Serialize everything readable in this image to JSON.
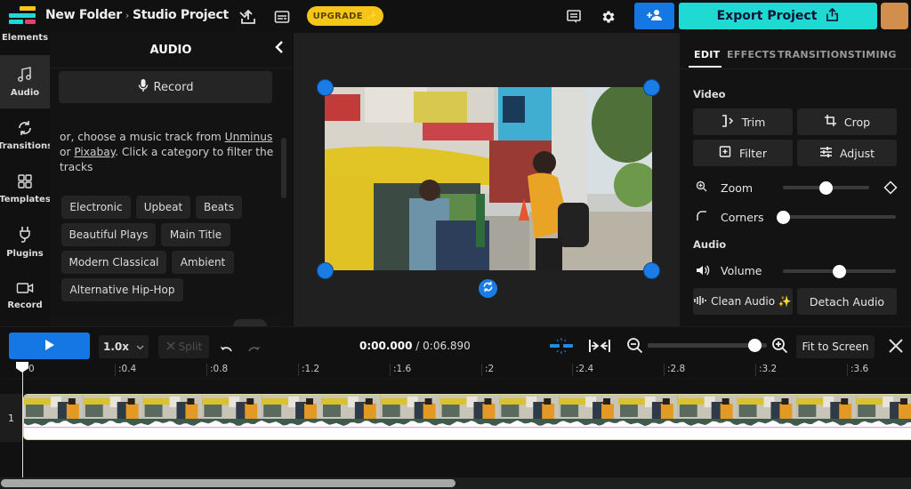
{
  "topbar": {
    "breadcrumb_folder": "New Folder",
    "breadcrumb_sep": "›",
    "project_title": "Studio Project",
    "upgrade_label": "UPGRADE ✨",
    "export_label": "Export Project",
    "colors": {
      "accent_blue": "#1577e3",
      "export_teal": "#1fd9d3",
      "upgrade_yellow": "#f5c518",
      "avatar": "#d28e4c"
    }
  },
  "rail": {
    "items": [
      {
        "label": "Elements"
      },
      {
        "label": "Audio"
      },
      {
        "label": "Transitions"
      },
      {
        "label": "Templates"
      },
      {
        "label": "Plugins"
      },
      {
        "label": "Record"
      }
    ]
  },
  "audio_panel": {
    "title": "AUDIO",
    "record_label": "Record",
    "desc_prefix": "or, choose a music track from ",
    "link_unminus": "Unminus",
    "desc_or": " or ",
    "link_pixabay": "Pixabay",
    "desc_suffix": ". Click a category to filter the tracks",
    "categories": [
      "Electronic",
      "Upbeat",
      "Beats",
      "Beautiful Plays",
      "Main Title",
      "Modern Classical",
      "Ambient",
      "Alternative Hip-Hop"
    ]
  },
  "right_panel": {
    "tabs": [
      "EDIT",
      "EFFECTS",
      "TRANSITIONS",
      "TIMING"
    ],
    "active_tab": "EDIT",
    "video_section": "Video",
    "buttons": {
      "trim": "Trim",
      "crop": "Crop",
      "filter": "Filter",
      "adjust": "Adjust"
    },
    "zoom_label": "Zoom",
    "zoom_value": 0.5,
    "corners_label": "Corners",
    "corners_value": 0,
    "audio_section": "Audio",
    "volume_label": "Volume",
    "volume_value": 0.5,
    "clean_audio": "Clean Audio ✨",
    "detach_audio": "Detach Audio"
  },
  "transport": {
    "speed": "1.0x",
    "split_label": "Split",
    "current_time": "0:00.000",
    "time_sep": " / ",
    "duration": "0:06.890",
    "timeline_zoom_value": 0.9,
    "fit_label": "Fit to Screen"
  },
  "timeline": {
    "ticks": [
      "0",
      ":0.4",
      ":0.8",
      ":1.2",
      ":1.6",
      ":2",
      ":2.4",
      ":2.8",
      ":3.2",
      ":3.6"
    ],
    "track_number": "1",
    "playhead_time": "0:00.000",
    "scroll_fraction": 0.5
  }
}
